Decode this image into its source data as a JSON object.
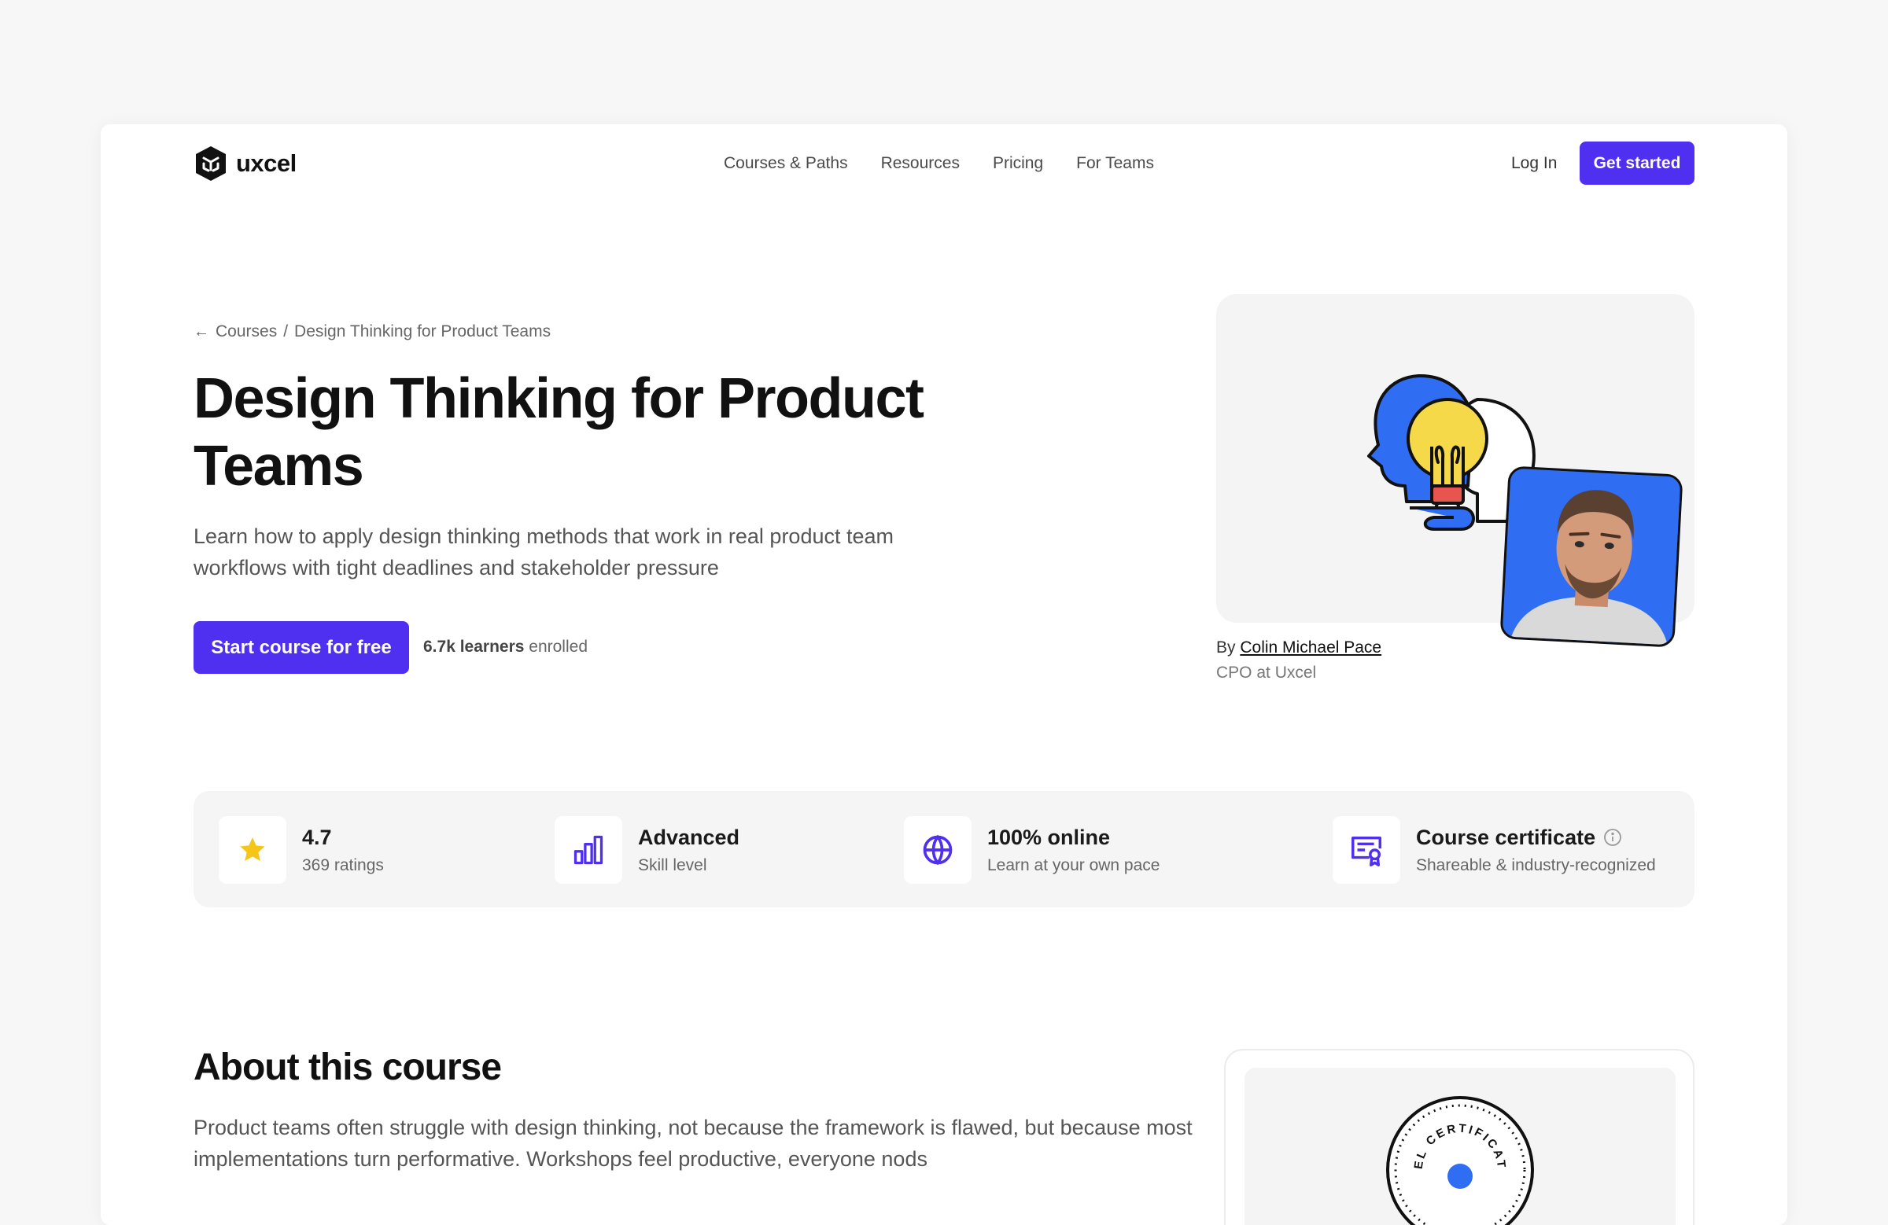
{
  "nav": {
    "brand": "uxcel",
    "links": [
      "Courses & Paths",
      "Resources",
      "Pricing",
      "For Teams"
    ],
    "login": "Log In",
    "get_started": "Get started"
  },
  "breadcrumb": {
    "parent": "Courses",
    "separator": "/",
    "current": "Design Thinking for Product Teams"
  },
  "hero": {
    "title": "Design Thinking for Product Teams",
    "subtitle": "Learn how to apply design thinking methods that work in real product team workflows with tight deadlines and stakeholder pressure",
    "cta": "Start course for free",
    "learners_count": "6.7k learners",
    "learners_suffix": "enrolled"
  },
  "author": {
    "by": "By",
    "name": "Colin Michael Pace",
    "role": "CPO at Uxcel"
  },
  "stats": [
    {
      "icon": "star-icon",
      "main": "4.7",
      "sub": "369 ratings"
    },
    {
      "icon": "bar-chart-icon",
      "main": "Advanced",
      "sub": "Skill level"
    },
    {
      "icon": "globe-icon",
      "main": "100% online",
      "sub": "Learn at your own pace"
    },
    {
      "icon": "certificate-icon",
      "main": "Course certificate",
      "sub": "Shareable & industry-recognized"
    }
  ],
  "about": {
    "title": "About this course",
    "text": "Product teams often struggle with design thinking, not because the framework is flawed, but because most implementations turn performative. Workshops feel productive, everyone nods"
  },
  "certificate": {
    "seal_text": "CEL CERTIFICATE"
  },
  "colors": {
    "accent": "#4f2ff0",
    "star": "#f5c518",
    "photo_bg": "#2f6df2"
  }
}
